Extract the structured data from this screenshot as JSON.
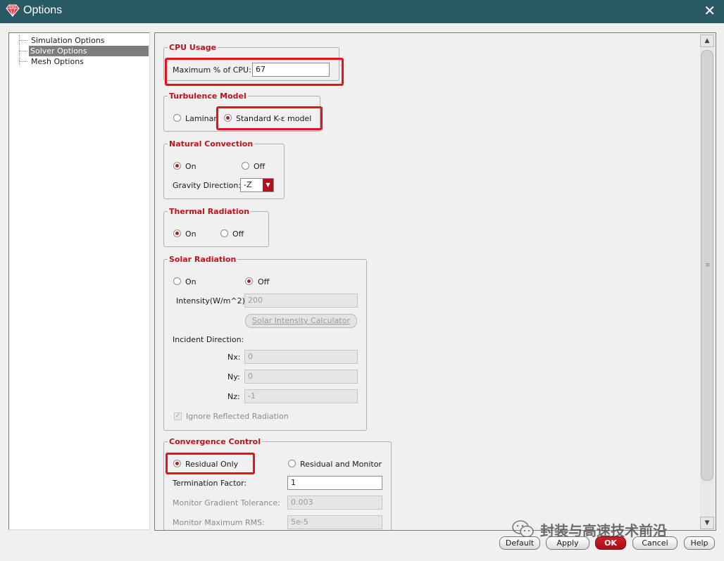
{
  "window": {
    "title": "Options",
    "close_icon": "close-icon",
    "logo_icon": "gem-logo-icon"
  },
  "tree": {
    "items": [
      {
        "label": "Simulation Options",
        "selected": false
      },
      {
        "label": "Solver Options",
        "selected": true
      },
      {
        "label": "Mesh Options",
        "selected": false
      }
    ]
  },
  "cpu": {
    "legend": "CPU Usage",
    "label": "Maximum % of CPU:",
    "value": "67"
  },
  "turbulence": {
    "legend": "Turbulence Model",
    "laminar_label": "Laminar",
    "standard_label": "Standard K-ε model",
    "selected": "standard"
  },
  "natural_convection": {
    "legend": "Natural Convection",
    "on_label": "On",
    "off_label": "Off",
    "selected": "on",
    "gravity_label": "Gravity Direction:",
    "gravity_value": "-Z"
  },
  "thermal_radiation": {
    "legend": "Thermal Radiation",
    "on_label": "On",
    "off_label": "Off",
    "selected": "on"
  },
  "solar_radiation": {
    "legend": "Solar Radiation",
    "on_label": "On",
    "off_label": "Off",
    "selected": "off",
    "intensity_label": "Intensity(W/m^2):",
    "intensity_value": "200",
    "calculator_label": "Solar Intensity Calculator",
    "incident_label": "Incident Direction:",
    "nx_label": "Nx:",
    "nx_value": "0",
    "ny_label": "Ny:",
    "ny_value": "0",
    "nz_label": "Nz:",
    "nz_value": "-1",
    "ignore_label": "Ignore Reflected Radiation",
    "ignore_checked": true
  },
  "convergence": {
    "legend": "Convergence Control",
    "residual_only_label": "Residual Only",
    "residual_monitor_label": "Residual and Monitor",
    "selected": "residual_only",
    "termination_label": "Termination Factor:",
    "termination_value": "1",
    "gradient_label": "Monitor Gradient Tolerance:",
    "gradient_value": "0.003",
    "rms_label": "Monitor Maximum RMS:",
    "rms_value": "5e-5"
  },
  "buttons": {
    "default": "Default",
    "apply": "Apply",
    "ok": "OK",
    "cancel": "Cancel",
    "help": "Help"
  },
  "watermark": {
    "text": "封装与高速技术前沿",
    "icon": "wechat-icon"
  },
  "colors": {
    "titlebar": "#275a63",
    "accent_red": "#c0121b",
    "highlight_box": "#e5121c"
  }
}
